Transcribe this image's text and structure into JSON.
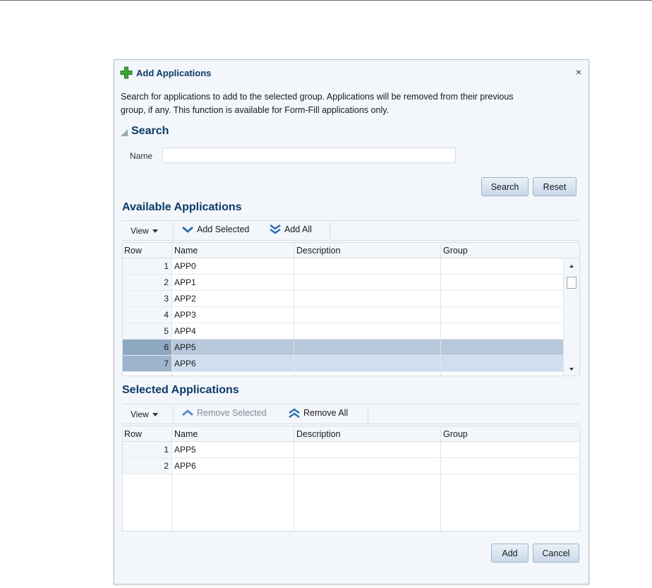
{
  "dialog": {
    "title": "Add Applications",
    "close_glyph": "×",
    "intro_line1": "Search for applications to add to the selected group. Applications will be removed from their previous",
    "intro_line2": "group, if any. This function is available for Form-Fill applications only."
  },
  "search": {
    "header": "Search",
    "name_label": "Name",
    "name_value": "",
    "search_button": "Search",
    "reset_button": "Reset"
  },
  "available": {
    "title": "Available Applications",
    "toolbar": {
      "view": "View",
      "add_selected": "Add Selected",
      "add_all": "Add All"
    },
    "columns": [
      "Row",
      "Name",
      "Description",
      "Group"
    ],
    "rows": [
      {
        "row": "1",
        "name": "APP0",
        "description": "",
        "group": "",
        "state": ""
      },
      {
        "row": "2",
        "name": "APP1",
        "description": "",
        "group": "",
        "state": ""
      },
      {
        "row": "3",
        "name": "APP2",
        "description": "",
        "group": "",
        "state": ""
      },
      {
        "row": "4",
        "name": "APP3",
        "description": "",
        "group": "",
        "state": ""
      },
      {
        "row": "5",
        "name": "APP4",
        "description": "",
        "group": "",
        "state": ""
      },
      {
        "row": "6",
        "name": "APP5",
        "description": "",
        "group": "",
        "state": "selected"
      },
      {
        "row": "7",
        "name": "APP6",
        "description": "",
        "group": "",
        "state": "selected-focused"
      }
    ]
  },
  "selected": {
    "title": "Selected Applications",
    "toolbar": {
      "view": "View",
      "remove_selected": "Remove Selected",
      "remove_all": "Remove All"
    },
    "columns": [
      "Row",
      "Name",
      "Description",
      "Group"
    ],
    "rows": [
      {
        "row": "1",
        "name": "APP5",
        "description": "",
        "group": ""
      },
      {
        "row": "2",
        "name": "APP6",
        "description": "",
        "group": ""
      }
    ]
  },
  "footer": {
    "add_button": "Add",
    "cancel_button": "Cancel"
  },
  "colors": {
    "title_blue": "#0c3b68",
    "selected_row": "#b7c8da",
    "focused_row": "#cfdff0",
    "add_green": "#3aa832"
  },
  "icons": {
    "title": "green-plus-icon",
    "add_selected": "chevron-down-icon",
    "add_all": "double-chevron-down-icon",
    "remove_selected": "chevron-up-icon",
    "remove_all": "double-chevron-up-icon"
  }
}
